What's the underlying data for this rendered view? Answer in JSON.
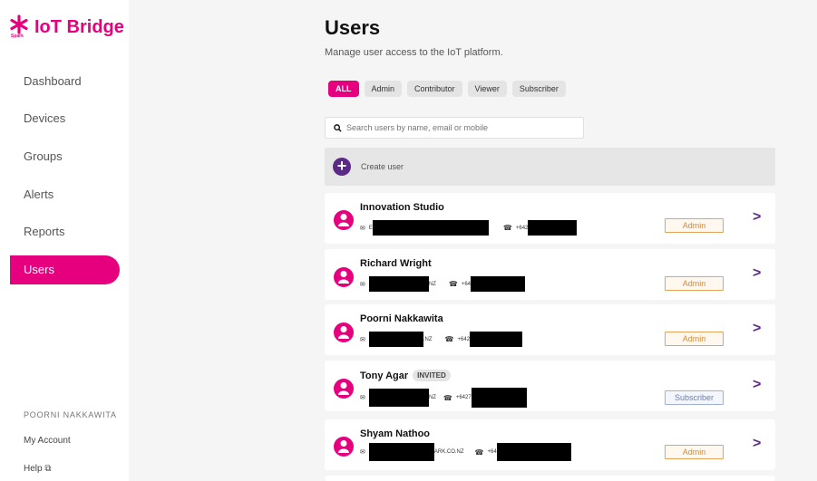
{
  "app": {
    "brand": "IoT Bridge",
    "brand_sub": "Spark",
    "accent": "#e6007e",
    "secondary": "#5b2a86"
  },
  "sidebar": {
    "items": [
      {
        "label": "Dashboard",
        "active": false
      },
      {
        "label": "Devices",
        "active": false
      },
      {
        "label": "Groups",
        "active": false
      },
      {
        "label": "Alerts",
        "active": false
      },
      {
        "label": "Reports",
        "active": false
      },
      {
        "label": "Users",
        "active": true
      }
    ],
    "user_name": "POORNI NAKKAWITA",
    "my_account": "My Account",
    "help": "Help ⧉"
  },
  "main": {
    "title": "Users",
    "subtitle": "Manage user access to the IoT platform.",
    "filters": [
      "ALL",
      "Admin",
      "Contributor",
      "Viewer",
      "Subscriber"
    ],
    "search_placeholder": "Search users by name, email or mobile",
    "create_label": "Create user",
    "users": [
      {
        "name": "Innovation Studio",
        "invited": false,
        "email_prefix": "E",
        "email_suffix": "",
        "phone_prefix": "+642",
        "role": "Admin"
      },
      {
        "name": "Richard Wright",
        "invited": false,
        "email_prefix": "",
        "email_suffix": "NZ",
        "phone_prefix": "+64",
        "role": "Admin"
      },
      {
        "name": "Poorni Nakkawita",
        "invited": false,
        "email_prefix": "",
        "email_suffix": ".NZ",
        "phone_prefix": "+642",
        "role": "Admin"
      },
      {
        "name": "Tony Agar",
        "invited": true,
        "invited_label": "INVITED",
        "email_prefix": "",
        "email_suffix": "NZ",
        "phone_prefix": "+6427",
        "role": "Subscriber"
      },
      {
        "name": "Shyam Nathoo",
        "invited": false,
        "email_prefix": "",
        "email_suffix": "ARK.CO.NZ",
        "phone_prefix": "+64",
        "role": "Admin"
      }
    ]
  }
}
